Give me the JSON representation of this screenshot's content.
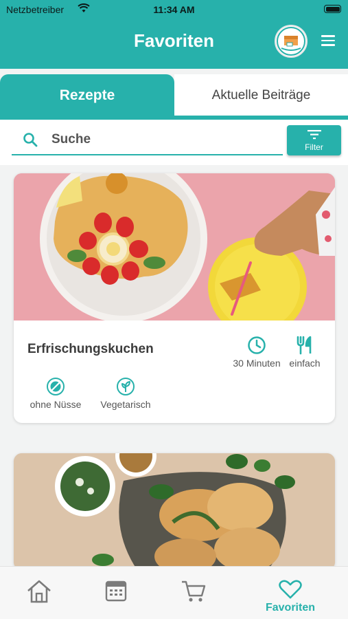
{
  "status_bar": {
    "carrier": "Netzbetreiber",
    "time": "11:34 AM"
  },
  "header": {
    "title": "Favoriten"
  },
  "tabs": [
    {
      "label": "Rezepte",
      "active": true
    },
    {
      "label": "Aktuelle Beiträge",
      "active": false
    }
  ],
  "search": {
    "placeholder": "Suche",
    "value": ""
  },
  "filter": {
    "label": "Filter"
  },
  "recipes": [
    {
      "title": "Erfrischungskuchen",
      "time": "30 Minuten",
      "difficulty": "einfach",
      "tags": [
        "ohne Nüsse",
        "Vegetarisch"
      ]
    }
  ],
  "bottom_nav": {
    "items": [
      "home-icon",
      "calendar-icon",
      "cart-icon",
      "heart-icon"
    ],
    "active_label": "Favoriten"
  },
  "colors": {
    "accent": "#27b1ab",
    "background": "#f2f3f3"
  }
}
